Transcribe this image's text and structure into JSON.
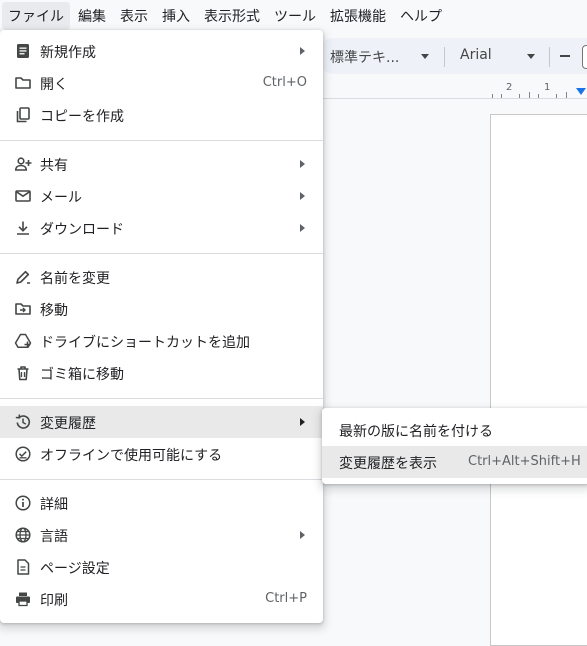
{
  "menubar": {
    "items": [
      "ファイル",
      "編集",
      "表示",
      "挿入",
      "表示形式",
      "ツール",
      "拡張機能",
      "ヘルプ"
    ]
  },
  "toolbar": {
    "style": "標準テキ...",
    "font": "Arial"
  },
  "ruler": {
    "labels": [
      "2",
      "1"
    ]
  },
  "file_menu": {
    "new": {
      "label": "新規作成",
      "icon": "doc-icon"
    },
    "open": {
      "label": "開く",
      "shortcut": "Ctrl+O",
      "icon": "folder-icon"
    },
    "copy": {
      "label": "コピーを作成",
      "icon": "copy-icon"
    },
    "share": {
      "label": "共有",
      "icon": "person-add-icon"
    },
    "email": {
      "label": "メール",
      "icon": "mail-icon"
    },
    "download": {
      "label": "ダウンロード",
      "icon": "download-icon"
    },
    "rename": {
      "label": "名前を変更",
      "icon": "pencil-icon"
    },
    "move": {
      "label": "移動",
      "icon": "folder-move-icon"
    },
    "shortcut": {
      "label": "ドライブにショートカットを追加",
      "icon": "drive-add-icon"
    },
    "trash": {
      "label": "ゴミ箱に移動",
      "icon": "trash-icon"
    },
    "history": {
      "label": "変更履歴",
      "icon": "history-icon"
    },
    "offline": {
      "label": "オフラインで使用可能にする",
      "icon": "offline-check-icon"
    },
    "details": {
      "label": "詳細",
      "icon": "info-icon"
    },
    "language": {
      "label": "言語",
      "icon": "globe-icon"
    },
    "page_setup": {
      "label": "ページ設定",
      "icon": "page-icon"
    },
    "print": {
      "label": "印刷",
      "shortcut": "Ctrl+P",
      "icon": "printer-icon"
    }
  },
  "history_submenu": {
    "name_version": {
      "label": "最新の版に名前を付ける"
    },
    "see_history": {
      "label": "変更履歴を表示",
      "shortcut": "Ctrl+Alt+Shift+H"
    }
  },
  "colors": {
    "accent": "#1a73e8",
    "highlight": "#e9e9ea",
    "menubar_active": "#e8eaed"
  }
}
